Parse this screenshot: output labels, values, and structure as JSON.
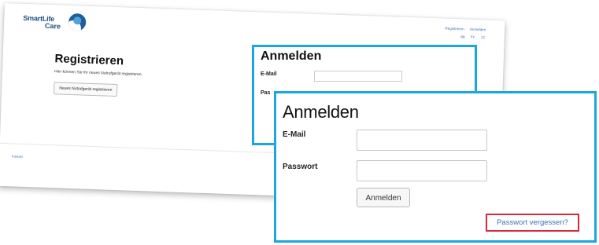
{
  "brand": {
    "line1": "SmartLife",
    "line2": "Care",
    "logo_icon": "smartlife-logo-icon"
  },
  "header": {
    "register_link": "Registrieren",
    "login_link": "Anmelden",
    "languages": [
      "de",
      "fr",
      "it"
    ]
  },
  "register": {
    "title": "Registrieren",
    "description": "Hier können Sie Ihr neues Notrufgerät registrieren.",
    "button": "Neues Notrufgerät registrieren"
  },
  "footer": {
    "contact": "Kontakt"
  },
  "login_small": {
    "title": "Anmelden",
    "email_label": "E-Mail",
    "password_label_partial": "Pas"
  },
  "login": {
    "title": "Anmelden",
    "email_label": "E-Mail",
    "email_value": "",
    "password_label": "Passwort",
    "password_value": "",
    "submit": "Anmelden",
    "forgot": "Passwort vergessen?"
  },
  "colors": {
    "highlight_blue": "#1aa7e0",
    "highlight_red": "#d42a3a",
    "link": "#3c73b6",
    "brand": "#1b4f85"
  }
}
